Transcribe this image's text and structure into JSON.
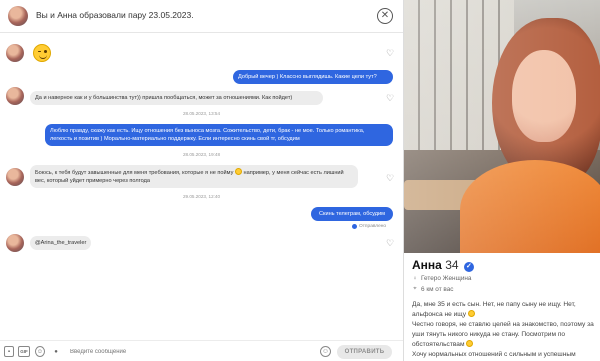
{
  "header": {
    "title": "Вы и Анна образовали пару 23.05.2023."
  },
  "messages": {
    "m2": "Добрый вечер ) Классно выглядишь. Какие цели тут?",
    "m3": "Да и наверное как и у большинства тут)) пришла пообщаться, может за отношениями. Как пойдет)",
    "t1": "28.05.2023, 13:54",
    "m4": "Люблю правду, скажу как есть. Ищу отношения без выноса мозга. Сожительство, дети, брак - не мое. Только романтика, легкость и позитив ) Морально-материально поддержку. Если интересно скинь свой тг, обсудим",
    "t2": "28.05.2023, 19:48",
    "m5": "Боюсь, к тебя будут завышенные для меня требования, которые я не пойму",
    "m5b": " например, у меня сейчас есть лишний вес, который уйдет примерно через полгода",
    "t3": "29.05.2023, 12:40",
    "m6": "Скинь телеграм, обсудим",
    "sent_status": "Отправлено",
    "m7": "@Arina_the_traveler"
  },
  "composer": {
    "placeholder": "Введите сообщение",
    "send_label": "ОТПРАВИТЬ",
    "gif_label": "GIF"
  },
  "profile": {
    "name": "Анна",
    "age": "34",
    "orientation": "Гетеро Женщина",
    "distance": "6 км от вас",
    "bio_1": "Да, мне 35 и есть сын. Нет, не папу сыну не ищу. Нет, альфонса не ищу",
    "bio_2": "Честно говоря, не ставлю целей на знакомство, поэтому за уши тянуть никого никуда не стану. Посмотрим по обстоятельствам",
    "bio_3": "Хочу нормальных отношений с сильным и успешным"
  },
  "icons": {
    "close": "close-icon",
    "heart": "heart-icon",
    "verified": "verified-badge-icon",
    "person": "person-icon",
    "location": "location-pin-icon",
    "image": "image-icon",
    "sticker": "sticker-icon",
    "mic": "microphone-icon",
    "emoji": "emoji-icon"
  },
  "colors": {
    "accent": "#2f66e0",
    "incoming_bubble": "#ececec",
    "send_button": "#e8e8e8"
  }
}
